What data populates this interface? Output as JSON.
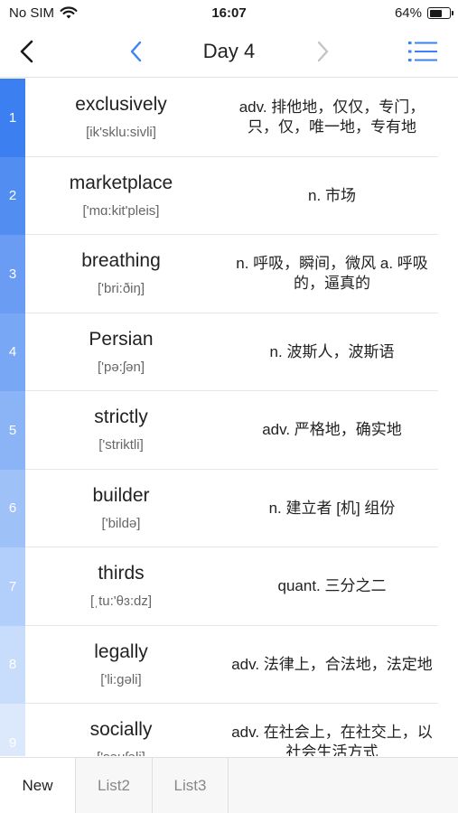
{
  "status": {
    "carrier": "No SIM",
    "time": "16:07",
    "battery": "64%",
    "battery_level": 0.64,
    "wifi_icon": "wifi-icon",
    "battery_icon": "battery-icon"
  },
  "nav": {
    "title": "Day 4",
    "back_icon": "chevron-left-icon",
    "prev_icon": "chevron-left-icon",
    "next_icon": "chevron-right-icon",
    "list_icon": "list-icon"
  },
  "colors": {
    "accent": "#3b82f6",
    "number_bar": [
      "#3c7ff0",
      "#528ef2",
      "#6a9cf3",
      "#78a7f5",
      "#8bb4f7",
      "#9ec1f8",
      "#b2cefa",
      "#c8ddfb",
      "#dce9fc"
    ]
  },
  "words": [
    {
      "num": "1",
      "word": "exclusively",
      "phonetic": "[ik'sklu:sivli]",
      "meaning": "adv. 排他地，仅仅，专门，只，仅，唯一地，专有地"
    },
    {
      "num": "2",
      "word": "marketplace",
      "phonetic": "['mɑ:kit'pleis]",
      "meaning": "n. 市场"
    },
    {
      "num": "3",
      "word": "breathing",
      "phonetic": "['bri:ðiŋ]",
      "meaning": "n. 呼吸，瞬间，微风 a. 呼吸的，逼真的"
    },
    {
      "num": "4",
      "word": "Persian",
      "phonetic": "['pə:ʃən]",
      "meaning": "n. 波斯人，波斯语"
    },
    {
      "num": "5",
      "word": "strictly",
      "phonetic": "['striktli]",
      "meaning": "adv. 严格地，确实地"
    },
    {
      "num": "6",
      "word": "builder",
      "phonetic": "['bildə]",
      "meaning": "n. 建立者 [机] 组份"
    },
    {
      "num": "7",
      "word": "thirds",
      "phonetic": "[ˌtu:'θɜ:dz]",
      "meaning": "quant. 三分之二"
    },
    {
      "num": "8",
      "word": "legally",
      "phonetic": "['li:gəli]",
      "meaning": "adv. 法律上，合法地，法定地"
    },
    {
      "num": "9",
      "word": "socially",
      "phonetic": "['səuʃəli]",
      "meaning": "adv. 在社会上，在社交上，以社会生活方式"
    }
  ],
  "tabs": [
    {
      "label": "New",
      "active": true
    },
    {
      "label": "List2",
      "active": false
    },
    {
      "label": "List3",
      "active": false
    }
  ]
}
